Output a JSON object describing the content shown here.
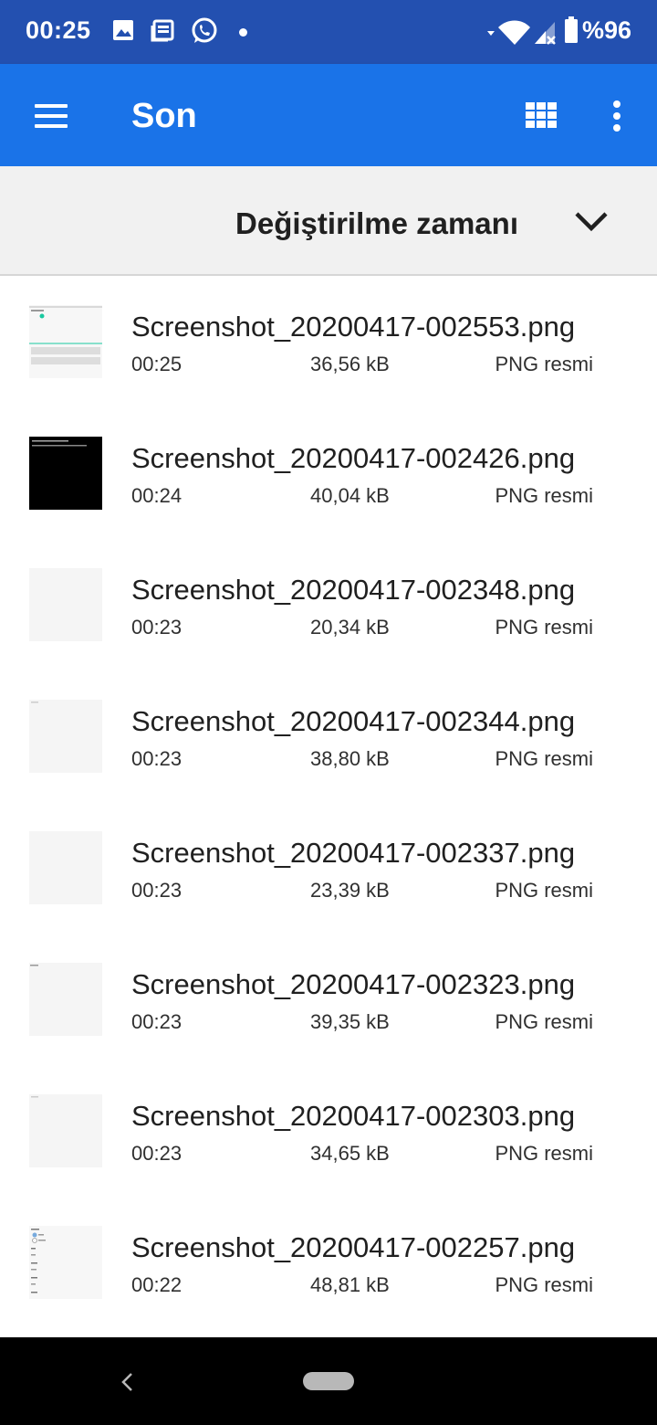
{
  "status_bar": {
    "time": "00:25",
    "battery": "%96",
    "icons": [
      "image-icon",
      "news-icon",
      "whatsapp-icon",
      "dot-icon",
      "wifi-icon",
      "signal-icon",
      "battery-icon"
    ]
  },
  "app_bar": {
    "title": "Son",
    "color": "#1a73e8"
  },
  "sort": {
    "label": "Değiştirilme zamanı"
  },
  "files": [
    {
      "name": "Screenshot_20200417-002553.png",
      "time": "00:25",
      "size": "36,56 kB",
      "type": "PNG resmi"
    },
    {
      "name": "Screenshot_20200417-002426.png",
      "time": "00:24",
      "size": "40,04 kB",
      "type": "PNG resmi"
    },
    {
      "name": "Screenshot_20200417-002348.png",
      "time": "00:23",
      "size": "20,34 kB",
      "type": "PNG resmi"
    },
    {
      "name": "Screenshot_20200417-002344.png",
      "time": "00:23",
      "size": "38,80 kB",
      "type": "PNG resmi"
    },
    {
      "name": "Screenshot_20200417-002337.png",
      "time": "00:23",
      "size": "23,39 kB",
      "type": "PNG resmi"
    },
    {
      "name": "Screenshot_20200417-002323.png",
      "time": "00:23",
      "size": "39,35 kB",
      "type": "PNG resmi"
    },
    {
      "name": "Screenshot_20200417-002303.png",
      "time": "00:23",
      "size": "34,65 kB",
      "type": "PNG resmi"
    },
    {
      "name": "Screenshot_20200417-002257.png",
      "time": "00:22",
      "size": "48,81 kB",
      "type": "PNG resmi"
    }
  ]
}
